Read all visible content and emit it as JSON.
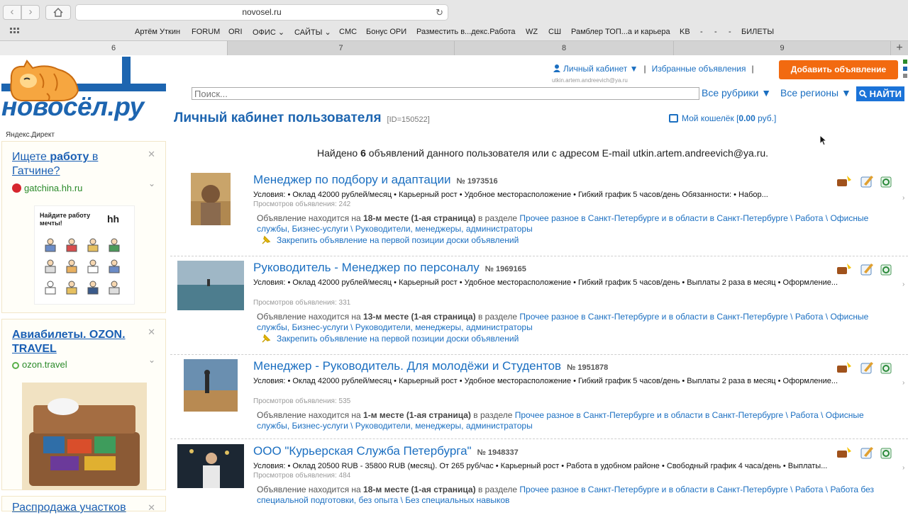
{
  "browser": {
    "url": "novosel.ru",
    "bookmarks": [
      "Артём Уткин",
      "FORUM",
      "ORI",
      "ОФИС",
      "САЙТЫ",
      "CMC",
      "Бонус ОРИ",
      "Разместить в...декс.Работа",
      "WZ",
      "СШ",
      "Рамблер ТОП...а и карьера",
      "KB",
      "-",
      "-",
      "-",
      "БИЛЕТЫ"
    ],
    "tabs": [
      "6",
      "7",
      "8",
      "9"
    ]
  },
  "header": {
    "logo_text": "новосёл.ру",
    "cabinet_link": "Личный кабинет ▼",
    "favorites_link": "Избранные объявления",
    "user_email_small": "utkin.artem.andreevich@ya.ru",
    "add_button": "Добавить объявление",
    "search_placeholder": "Поиск...",
    "rubrics_select": "Все рубрики ▼",
    "regions_select": "Все регионы ▼",
    "find_button": "НАЙТИ"
  },
  "main": {
    "title": "Личный кабинет пользователя",
    "user_id": "[ID=150522]",
    "wallet_label": "Мой кошелёк [",
    "wallet_amount": "0.00",
    "wallet_currency": "руб.]",
    "found_prefix": "Найдено",
    "found_count": "6",
    "found_suffix": "объявлений данного пользователя или с адресом E-mail utkin.artem.andreevich@ya.ru."
  },
  "sidebar": {
    "yandex_direct": "Яндекс.Директ",
    "ads": [
      {
        "title_a": "Ищете",
        "title_b": "работу",
        "title_c": "в Гатчине?",
        "domain": "gatchina.hh.ru",
        "banner_text": "Найдите работу мечты!",
        "banner_logo": "hh"
      },
      {
        "title_a": "Авиабилеты. OZON.",
        "title_b": "TRAVEL",
        "domain": "ozon.travel"
      },
      {
        "title_a": "Распродажа участков"
      }
    ]
  },
  "listings": [
    {
      "title": "Менеджер по подбору и адаптации",
      "number": "№ 1973516",
      "conditions": "Условия: • Оклад 42000 рублей/месяц • Карьерный рост • Удобное месторасположение • Гибкий график 5 часов/день Обязанности: • Набор...",
      "views": "Просмотров объявления: 242",
      "pos_prefix": "Объявление находится на",
      "pos_bold": "18-м месте (1-ая страница)",
      "pos_mid": "в разделе",
      "pos_link": "Прочее разное в Санкт-Петербурге и в области в Санкт-Петербурге \\ Работа \\ Офисные службы, Бизнес-услуги \\ Руководители, менеджеры, администраторы",
      "pin": "Закрепить объявление на первой позиции доски объявлений"
    },
    {
      "title": "Руководитель - Менеджер по персоналу",
      "number": "№ 1969165",
      "conditions": "Условия: • Оклад 42000 рублей/месяц • Карьерный рост • Удобное месторасположение • Гибкий график 5 часов/день • Выплаты 2 раза в месяц • Оформление...",
      "views": "Просмотров объявления: 331",
      "pos_prefix": "Объявление находится на",
      "pos_bold": "13-м месте (1-ая страница)",
      "pos_mid": "в разделе",
      "pos_link": "Прочее разное в Санкт-Петербурге и в области в Санкт-Петербурге \\ Работа \\ Офисные службы, Бизнес-услуги \\ Руководители, менеджеры, администраторы",
      "pin": "Закрепить объявление на первой позиции доски объявлений"
    },
    {
      "title": "Менеджер - Руководитель. Для молодёжи и Студентов",
      "number": "№ 1951878",
      "conditions": "Условия: • Оклад 42000 рублей/месяц • Карьерный рост • Удобное месторасположение • Гибкий график 5 часов/день • Выплаты 2 раза в месяц • Оформление...",
      "views": "Просмотров объявления: 535",
      "pos_prefix": "Объявление находится на",
      "pos_bold": "1-м месте (1-ая страница)",
      "pos_mid": "в разделе",
      "pos_link": "Прочее разное в Санкт-Петербурге и в области в Санкт-Петербурге \\ Работа \\ Офисные службы, Бизнес-услуги \\ Руководители, менеджеры, администраторы",
      "pin": ""
    },
    {
      "title": "ООО \"Курьерская Служба Петербурга\"",
      "number": "№ 1948337",
      "conditions": "Условия: • Оклад 20500 RUB - 35800 RUB (месяц). От 265 руб/час • Карьерный рост • Работа в удобном районе • Свободный график 4 часа/день • Выплаты...",
      "views": "Просмотров объявления: 484",
      "pos_prefix": "Объявление находится на",
      "pos_bold": "18-м месте (1-ая страница)",
      "pos_mid": "в разделе",
      "pos_link": "Прочее разное в Санкт-Петербурге и в области в Санкт-Петербурге \\ Работа \\ Работа без специальной подготовки, без опыта \\ Без специальных навыков",
      "pin": ""
    }
  ],
  "colors": {
    "brand_blue": "#1d65b0",
    "link_blue": "#1b6fc1",
    "accent_orange": "#f26a10",
    "find_blue": "#1b73d8"
  }
}
